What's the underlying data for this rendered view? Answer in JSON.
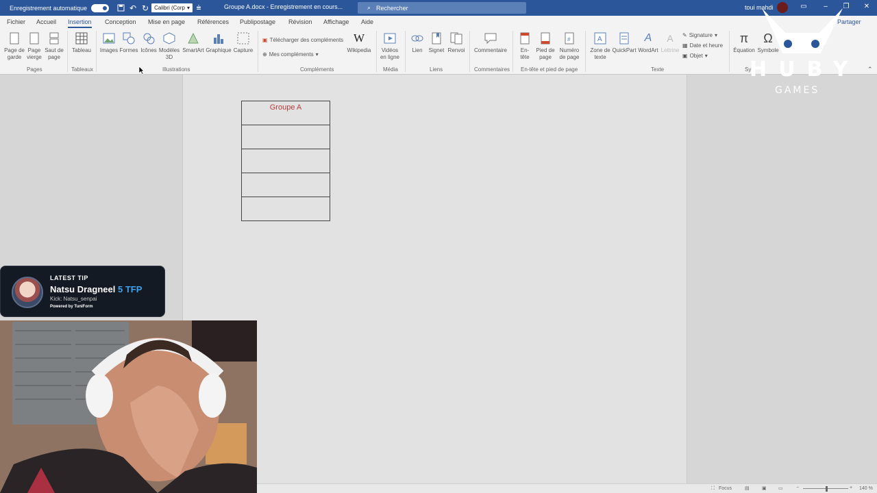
{
  "titlebar": {
    "autosave_label": "Enregistrement automatique",
    "font_name": "Calibri (Corp",
    "doc_title": "Groupe A.docx  -  Enregistrement en cours...",
    "search_placeholder": "Rechercher",
    "username": "toui mahdi"
  },
  "tabs": [
    "Fichier",
    "Accueil",
    "Insertion",
    "Conception",
    "Mise en page",
    "Références",
    "Publipostage",
    "Révision",
    "Affichage",
    "Aide"
  ],
  "active_tab": "Insertion",
  "share_label": "Partager",
  "ribbon": {
    "pages": {
      "group": "Pages",
      "items": [
        "Page de garde",
        "Page vierge",
        "Saut de page"
      ]
    },
    "tableaux": {
      "group": "Tableaux",
      "items": [
        "Tableau"
      ]
    },
    "illustrations": {
      "group": "Illustrations",
      "items": [
        "Images",
        "Formes",
        "Icônes",
        "Modèles 3D",
        "SmartArt",
        "Graphique",
        "Capture"
      ]
    },
    "complements": {
      "group": "Compléments",
      "download": "Télécharger des compléments",
      "mine": "Mes compléments",
      "wikipedia": "Wikipedia"
    },
    "media": {
      "group": "Média",
      "items": [
        "Vidéos en ligne"
      ]
    },
    "liens": {
      "group": "Liens",
      "items": [
        "Lien",
        "Signet",
        "Renvoi"
      ]
    },
    "commentaires": {
      "group": "Commentaires",
      "items": [
        "Commentaire"
      ]
    },
    "entete": {
      "group": "En-tête et pied de page",
      "items": [
        "En-tête",
        "Pied de page",
        "Numéro de page"
      ]
    },
    "texte": {
      "group": "Texte",
      "items": [
        "Zone de texte",
        "QuickPart",
        "WordArt",
        "Lettrine"
      ],
      "signature": "Signature",
      "date": "Date et heure",
      "objet": "Objet"
    },
    "symboles": {
      "group": "Sy",
      "items": [
        "Équation",
        "Symbole"
      ]
    }
  },
  "document": {
    "table_title": "Groupe A",
    "rows": [
      "",
      "",
      "",
      ""
    ]
  },
  "statusbar": {
    "focus": "Focus",
    "zoom": "140 %"
  },
  "logo": {
    "text": "HUBY",
    "sub": "GAMES"
  },
  "tip": {
    "label": "LATEST TIP",
    "name": "Natsu Dragneel",
    "amount": "5 TFP",
    "kick": "Kick: Natsu_senpai",
    "powered": "Powered by TuniForm"
  },
  "colors": {
    "title_bar": "#2b569a",
    "accent_red": "#b83b3b",
    "tip_amount": "#3fa3f0"
  }
}
